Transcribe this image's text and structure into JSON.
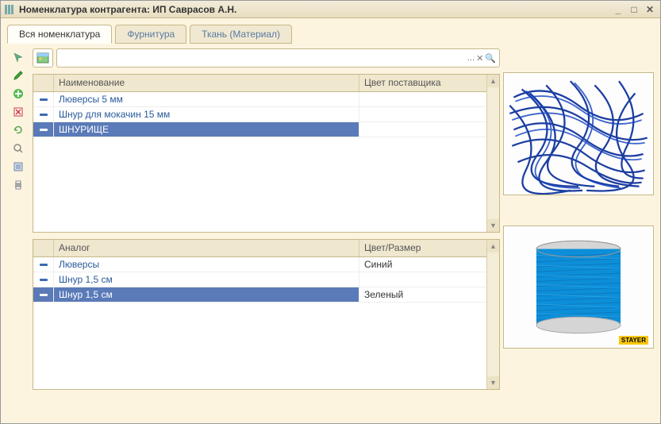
{
  "window": {
    "title": "Номенклатура контрагента: ИП Саврасов А.Н."
  },
  "tabs": [
    {
      "label": "Вся номенклатура",
      "active": true
    },
    {
      "label": "Фурнитура",
      "active": false
    },
    {
      "label": "Ткань (Материал)",
      "active": false
    }
  ],
  "search": {
    "value": "",
    "placeholder": ""
  },
  "top_grid": {
    "columns": {
      "name": "Наименование",
      "color": "Цвет поставщика"
    },
    "rows": [
      {
        "name": "Люверсы 5 мм",
        "color": "",
        "selected": false
      },
      {
        "name": "Шнур для мокачин 15 мм",
        "color": "",
        "selected": false
      },
      {
        "name": "ШНУРИЩЕ",
        "color": "",
        "selected": true
      }
    ]
  },
  "bottom_grid": {
    "columns": {
      "name": "Аналог",
      "color": "Цвет/Размер"
    },
    "rows": [
      {
        "name": "Люверсы",
        "color": "Синий",
        "selected": false
      },
      {
        "name": "Шнур 1,5 см",
        "color": "",
        "selected": false
      },
      {
        "name": "Шнур 1,5 см",
        "color": "Зеленый",
        "selected": true
      }
    ]
  },
  "preview_brand": "STAYER"
}
